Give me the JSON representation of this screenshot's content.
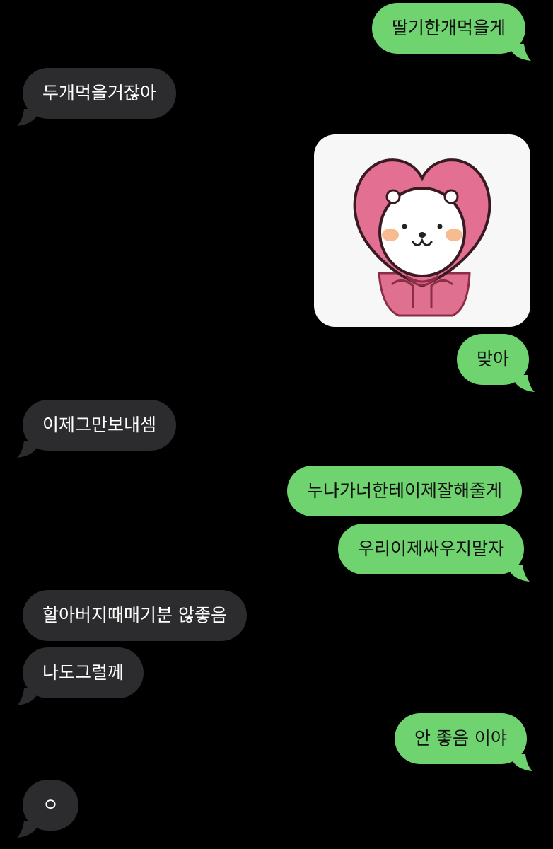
{
  "colors": {
    "background": "#000000",
    "sent_bubble": "#6fd46f",
    "received_bubble": "#2c2c2e",
    "sent_text": "#111111",
    "received_text": "#ffffff"
  },
  "messages": [
    {
      "side": "sent",
      "text": "딸기한개먹을게"
    },
    {
      "side": "received",
      "text": "두개먹을거잖아"
    },
    {
      "side": "sent",
      "type": "sticker",
      "sticker": "heart-hood-bear-sticker"
    },
    {
      "side": "sent",
      "text": "맞아"
    },
    {
      "side": "received",
      "text": "이제그만보내셈"
    },
    {
      "side": "sent",
      "text": "누나가너한테이제잘해줄게"
    },
    {
      "side": "sent",
      "text": "우리이제싸우지말자"
    },
    {
      "side": "received",
      "text": "할아버지때매기분 않좋음"
    },
    {
      "side": "received",
      "text": "나도그럴께"
    },
    {
      "side": "sent",
      "text": "안 좋음 이야"
    },
    {
      "side": "received",
      "text": "ㅇ"
    }
  ]
}
